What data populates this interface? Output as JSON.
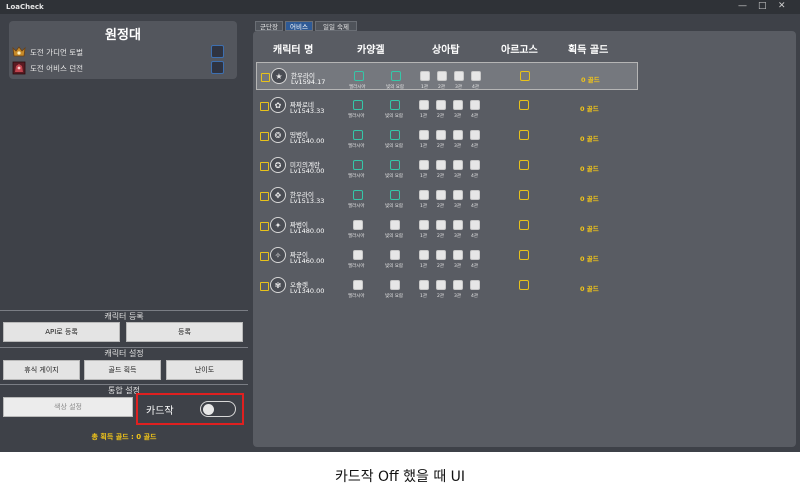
{
  "window": {
    "title": "LoaCheck",
    "min": "—",
    "max": "□",
    "close": "✕"
  },
  "left": {
    "raid_group": {
      "title": "원정대",
      "items": [
        {
          "label": "도전 가디언 토벌",
          "icon": "guardian-icon"
        },
        {
          "label": "도전 어비스 던전",
          "icon": "abyss-icon"
        }
      ]
    },
    "register": {
      "title": "캐릭터 등록",
      "api_button": "API로 등록",
      "register_button": "등록"
    },
    "character_settings": {
      "title": "캐릭터 설정",
      "rest_gauge_button": "휴식 게이지",
      "gold_button": "골드 획득",
      "difficulty_button": "난이도"
    },
    "general_settings": {
      "title": "통합 설정",
      "color_button": "색상 설정",
      "card_label": "카드작",
      "card_toggle_on": false
    },
    "total_gold": "총 획득 골드 : 0 골드"
  },
  "tabs": [
    {
      "label": "군단장",
      "active": false
    },
    {
      "label": "어비스",
      "active": true
    },
    {
      "label": "일일 숙제",
      "active": false
    }
  ],
  "table": {
    "headers": {
      "character": "캐릭터 명",
      "kayangel": "카양겔",
      "tower": "상아탑",
      "argos": "아르고스",
      "gold": "획득 골드"
    },
    "kayangel_sublabels": [
      "엘라시아",
      "빛의 요람"
    ],
    "tower_sublabels": [
      "1관",
      "2관",
      "3관",
      "4관"
    ],
    "rows": [
      {
        "name": "한우라이",
        "level": "Lv1594.17",
        "icon": "★",
        "kayangel_green": true,
        "gold": "0 골드",
        "selected": true
      },
      {
        "name": "짜짜로네",
        "level": "Lv1543.33",
        "icon": "✿",
        "kayangel_green": true,
        "gold": "0 골드",
        "selected": false
      },
      {
        "name": "띵범이",
        "level": "Lv1540.00",
        "icon": "❂",
        "kayangel_green": true,
        "gold": "0 골드",
        "selected": false
      },
      {
        "name": "미지의계란",
        "level": "Lv1540.00",
        "icon": "✪",
        "kayangel_green": true,
        "gold": "0 골드",
        "selected": false
      },
      {
        "name": "한우라이",
        "level": "Lv1513.33",
        "icon": "✥",
        "kayangel_green": true,
        "gold": "0 골드",
        "selected": false
      },
      {
        "name": "짜범이",
        "level": "Lv1480.00",
        "icon": "✦",
        "kayangel_green": false,
        "gold": "0 골드",
        "selected": false
      },
      {
        "name": "짜군이",
        "level": "Lv1460.00",
        "icon": "✧",
        "kayangel_green": false,
        "gold": "0 골드",
        "selected": false
      },
      {
        "name": "오솔렛",
        "level": "Lv1340.00",
        "icon": "✾",
        "kayangel_green": false,
        "gold": "0 골드",
        "selected": false
      }
    ]
  },
  "caption": "카드작 Off 했을 때 UI"
}
